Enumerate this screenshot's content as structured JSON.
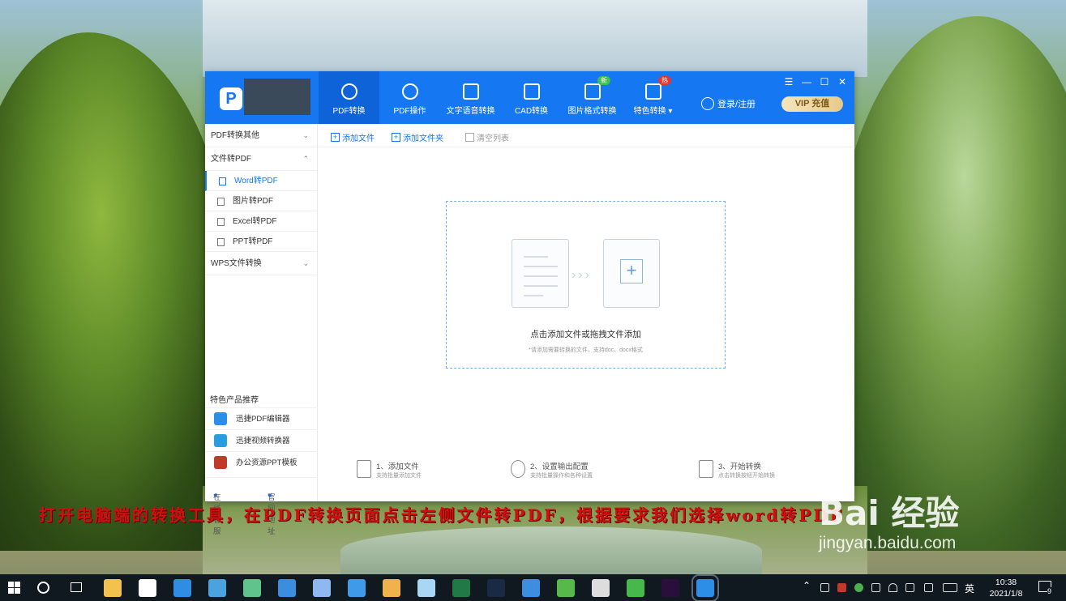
{
  "app": {
    "logo_letter": "P",
    "nav": [
      {
        "label": "PDF转换",
        "icon": "pdf-convert-icon",
        "active": true
      },
      {
        "label": "PDF操作",
        "icon": "pdf-operate-icon"
      },
      {
        "label": "文字语音转换",
        "icon": "audio-wave-icon"
      },
      {
        "label": "CAD转换",
        "icon": "cad-icon"
      },
      {
        "label": "图片格式转换",
        "icon": "image-icon",
        "badge": "新"
      },
      {
        "label": "特色转换",
        "icon": "star-convert-icon",
        "badge": "热",
        "dropdown": "▾"
      }
    ],
    "login_label": "登录/注册",
    "vip_label": "VIP 充值",
    "window_controls": [
      "☰",
      "—",
      "☐",
      "✕"
    ]
  },
  "sidebar": {
    "groups": [
      {
        "label": "PDF转换其他",
        "chevron": "⌄"
      },
      {
        "label": "文件转PDF",
        "chevron": "⌃"
      },
      {
        "label": "WPS文件转换",
        "chevron": "⌄"
      }
    ],
    "items": [
      {
        "label": "Word转PDF",
        "active": true
      },
      {
        "label": "图片转PDF"
      },
      {
        "label": "Excel转PDF"
      },
      {
        "label": "PPT转PDF"
      }
    ],
    "recommend_title": "特色产品推荐",
    "recommend": [
      {
        "label": "迅捷PDF编辑器",
        "color": "#2d8ee8"
      },
      {
        "label": "迅捷视频转换器",
        "color": "#2a9de0"
      },
      {
        "label": "办公资源PPT模板",
        "color": "#c0392b"
      }
    ],
    "footer": {
      "service": "在线客服",
      "website": "官网地址"
    }
  },
  "toolbar": {
    "add_file": "添加文件",
    "add_folder": "添加文件夹",
    "clear_list": "清空列表"
  },
  "dropzone": {
    "main_text": "点击添加文件或拖拽文件添加",
    "sub_text": "*请添加需要转换的文件，支持doc、docx格式",
    "arrows": "›››"
  },
  "steps": [
    {
      "title": "1、添加文件",
      "sub": "支持批量添加文件"
    },
    {
      "title": "2、设置输出配置",
      "sub": "支持批量操作和各种设置"
    },
    {
      "title": "3、开始转换",
      "sub": "点击转换按钮开始转换"
    }
  ],
  "caption": "打开电脑端的转换工具，在PDF转换页面点击左侧文件转PDF，根据要求我们选择word转PDF",
  "watermark": {
    "brand": "Bai 经验",
    "url": "jingyan.baidu.com"
  },
  "taskbar": {
    "time": "10:38",
    "date": "2021/1/8",
    "ime": "英",
    "notifications": "9",
    "pinned": [
      {
        "name": "file-explorer-icon",
        "color": "#f2c14e"
      },
      {
        "name": "store-icon",
        "color": "#ffffff"
      },
      {
        "name": "edge-icon",
        "color": "#2f8de4"
      },
      {
        "name": "browser-icon",
        "color": "#4aa3df"
      },
      {
        "name": "play-icon",
        "color": "#5fc38b"
      },
      {
        "name": "k-app-icon",
        "color": "#3b8de0"
      },
      {
        "name": "bird-app-icon",
        "color": "#8fb8f0"
      },
      {
        "name": "chat-app-icon",
        "color": "#3d9be9"
      },
      {
        "name": "puzzle-app-icon",
        "color": "#f0b24a"
      },
      {
        "name": "scissors-app-icon",
        "color": "#a9d6f5"
      },
      {
        "name": "excel-icon",
        "color": "#1f7a45"
      },
      {
        "name": "photoshop-icon",
        "color": "#1b2a44"
      },
      {
        "name": "phone-app-icon",
        "color": "#3d8de0"
      },
      {
        "name": "refresh-app-icon",
        "color": "#57b94a"
      },
      {
        "name": "settings-icon",
        "color": "#dddddd"
      },
      {
        "name": "green-box-icon",
        "color": "#45b949"
      },
      {
        "name": "premiere-icon",
        "color": "#2a0f3c"
      },
      {
        "name": "pdf-app-icon",
        "color": "#2d8ee8"
      }
    ]
  }
}
